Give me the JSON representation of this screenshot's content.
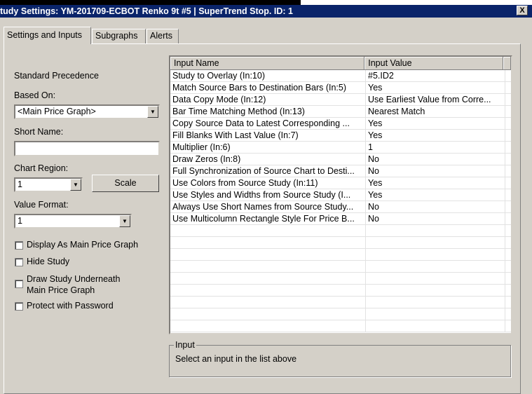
{
  "window": {
    "title": "tudy Settings: YM-201709-ECBOT  Renko 9t  #5 | SuperTrend Stop. ID: 1",
    "close": "X"
  },
  "tabs": [
    "Settings and Inputs",
    "Subgraphs",
    "Alerts"
  ],
  "left": {
    "precedence": "Standard Precedence",
    "based_on_label": "Based On:",
    "based_on_value": "<Main Price Graph>",
    "short_name_label": "Short Name:",
    "short_name_value": "",
    "chart_region_label": "Chart Region:",
    "chart_region_value": "1",
    "scale_button": "Scale",
    "value_format_label": "Value Format:",
    "value_format_value": "1",
    "checkboxes": [
      {
        "label": "Display As Main Price Graph",
        "checked": false
      },
      {
        "label": "Hide Study",
        "checked": false
      },
      {
        "label": "Draw Study Underneath",
        "label2": "Main Price Graph",
        "checked": false
      },
      {
        "label": "Protect with Password",
        "checked": false
      }
    ]
  },
  "grid": {
    "headers": [
      "Input Name",
      "Input Value"
    ],
    "rows": [
      [
        "Study to Overlay   (In:10)",
        "#5.ID2"
      ],
      [
        "Match Source Bars to Destination Bars   (In:5)",
        "Yes"
      ],
      [
        "Data Copy Mode   (In:12)",
        "Use Earliest Value from Corre..."
      ],
      [
        "Bar Time Matching Method   (In:13)",
        "Nearest Match"
      ],
      [
        "Copy Source Data to Latest Corresponding ...",
        "Yes"
      ],
      [
        "Fill Blanks With Last Value   (In:7)",
        "Yes"
      ],
      [
        "Multiplier   (In:6)",
        "1"
      ],
      [
        "Draw Zeros   (In:8)",
        "No"
      ],
      [
        "Full Synchronization of Source Chart to Desti...",
        "No"
      ],
      [
        "Use Colors from Source Study   (In:11)",
        "Yes"
      ],
      [
        "Use Styles and Widths from Source Study   (I...",
        "Yes"
      ],
      [
        "Always Use Short Names from Source Study...",
        "No"
      ],
      [
        "Use Multicolumn Rectangle Style For Price B...",
        "No"
      ]
    ]
  },
  "input_group": {
    "title": "Input",
    "text": "Select an input in the list above"
  }
}
